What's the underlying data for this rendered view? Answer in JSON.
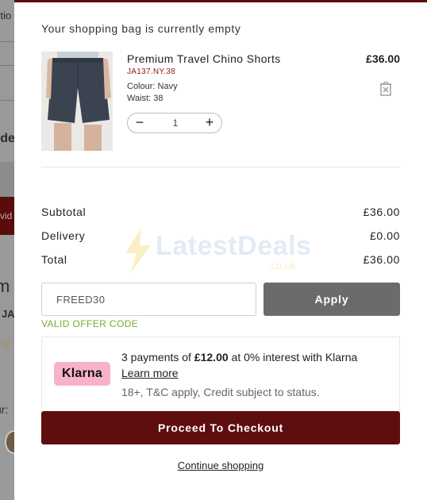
{
  "background": {
    "fragments": [
      "ctio",
      "rde",
      "vid",
      "m",
      ": JA",
      "ur:",
      "t:"
    ]
  },
  "cart": {
    "empty_message": "Your shopping bag is currently empty",
    "item": {
      "name": "Premium Travel Chino Shorts",
      "sku": "JA137.NY.38",
      "colour": "Colour: Navy",
      "waist": "Waist: 38",
      "price": "£36.00",
      "quantity": "1"
    },
    "summary": {
      "subtotal_label": "Subtotal",
      "subtotal_value": "£36.00",
      "delivery_label": "Delivery",
      "delivery_value": "£0.00",
      "total_label": "Total",
      "total_value": "£36.00"
    },
    "promo": {
      "code": "FREED30",
      "apply_label": "Apply",
      "valid_text": "VALID OFFER CODE"
    },
    "klarna": {
      "logo": "Klarna",
      "line1_prefix": "3 payments of ",
      "line1_amount": "£12.00",
      "line1_suffix": " at 0% interest with Klarna",
      "learn_more": "Learn more",
      "terms": "18+, T&C apply, Credit subject to status."
    },
    "checkout_label": "Proceed To Checkout",
    "continue_label": "Continue shopping"
  },
  "watermark": {
    "brand": "LatestDeals",
    "suffix": ".co.uk"
  },
  "colors": {
    "accent": "#5e0e0e",
    "valid": "#7cab2c",
    "klarna_pink": "#f8b1cb",
    "apply_grey": "#6b6b6b"
  }
}
